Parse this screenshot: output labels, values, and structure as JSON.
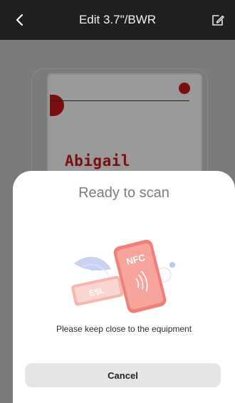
{
  "header": {
    "title": "Edit 3.7\"/BWR",
    "back_icon": "chevron-left-icon",
    "edit_icon": "edit-icon"
  },
  "label_preview": {
    "name": "Abigail"
  },
  "scan_sheet": {
    "title": "Ready to scan",
    "illustration": {
      "phone_text": "NFC",
      "tag_text": "ESL"
    },
    "message": "Please keep close to the equipment",
    "cancel_label": "Cancel"
  },
  "colors": {
    "header_bg": "#1f1f1f",
    "accent_red": "#e8413f",
    "dimmed_red": "#7a0f0f"
  }
}
